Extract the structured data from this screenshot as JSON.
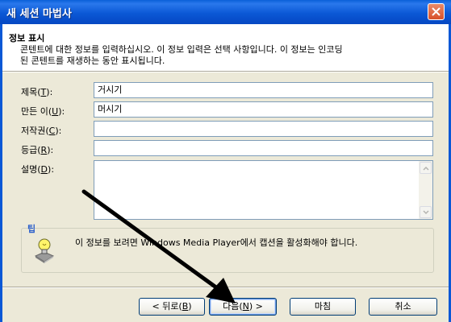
{
  "window": {
    "title": "새 세션 마법사"
  },
  "header": {
    "title": "정보 표시",
    "desc_line1": "콘텐트에 대한 정보를 입력하십시오. 이 정보 입력은 선택 사항입니다. 이 정보는 인코딩",
    "desc_line2": "된 콘텐트를 재생하는 동안 표시됩니다."
  },
  "fields": {
    "title": {
      "pre": "제목(",
      "key": "T",
      "post": "):",
      "value": "거시기"
    },
    "author": {
      "pre": "만든 이(",
      "key": "U",
      "post": "):",
      "value": "머시기"
    },
    "copyright": {
      "pre": "저작권(",
      "key": "C",
      "post": "):",
      "value": ""
    },
    "rating": {
      "pre": "등급(",
      "key": "R",
      "post": "):",
      "value": ""
    },
    "description": {
      "pre": "설명(",
      "key": "D",
      "post": "):",
      "value": ""
    }
  },
  "tip": {
    "label": "팁",
    "text": "이 정보를 보려면 Windows Media Player에서 캡션을 활성화해야 합니다.",
    "icon": "lightbulb-icon"
  },
  "buttons": {
    "back": {
      "pre": "< 뒤로(",
      "key": "B",
      "post": ")"
    },
    "next": {
      "pre": "다음(",
      "key": "N",
      "post": ") >"
    },
    "finish": {
      "label": "마침"
    },
    "cancel": {
      "label": "취소"
    }
  },
  "colors": {
    "titlebar": "#0b58d6",
    "dialog_bg": "#ece9d8",
    "input_border": "#7f9db9",
    "button_border": "#003c74"
  }
}
